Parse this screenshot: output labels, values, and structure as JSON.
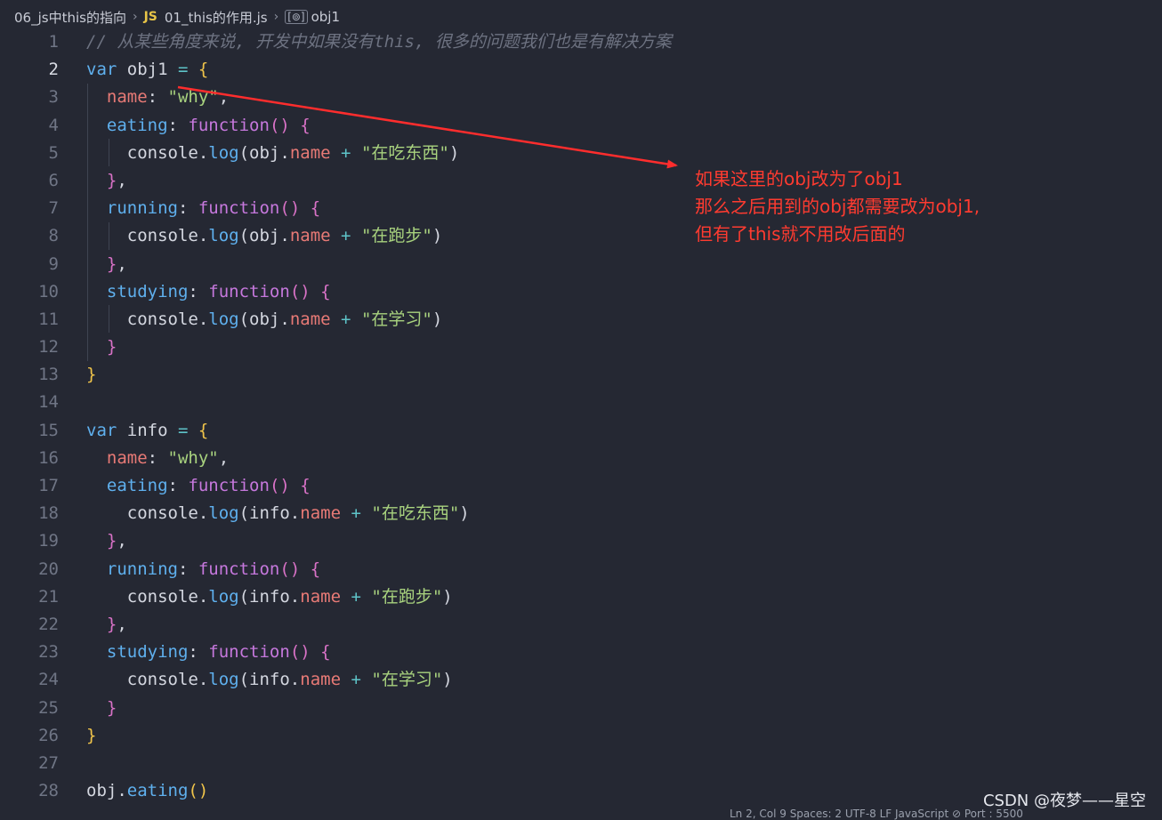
{
  "breadcrumb": {
    "folder": "06_js中this的指向",
    "file_type": "JS",
    "file": "01_this的作用.js",
    "symbol_icon": "symbol-variable-icon",
    "symbol": "obj1"
  },
  "editor": {
    "active_line": 2,
    "lines": [
      {
        "n": "1",
        "t": [
          {
            "c": "cmt",
            "v": "// 从某些角度来说, 开发中如果没有this, 很多的问题我们也是有解决方案"
          }
        ]
      },
      {
        "n": "2",
        "t": [
          {
            "c": "kwb",
            "v": "var"
          },
          {
            "c": "var",
            "v": " obj1 "
          },
          {
            "c": "op",
            "v": "="
          },
          {
            "c": "var",
            "v": " "
          },
          {
            "c": "br1",
            "v": "{"
          }
        ]
      },
      {
        "n": "3",
        "t": [
          {
            "c": "var",
            "v": "  "
          },
          {
            "c": "prop",
            "v": "name"
          },
          {
            "c": "var",
            "v": ": "
          },
          {
            "c": "str",
            "v": "\"why\""
          },
          {
            "c": "var",
            "v": ","
          }
        ]
      },
      {
        "n": "4",
        "t": [
          {
            "c": "var",
            "v": "  "
          },
          {
            "c": "fn",
            "v": "eating"
          },
          {
            "c": "var",
            "v": ": "
          },
          {
            "c": "kw",
            "v": "function"
          },
          {
            "c": "br2",
            "v": "()"
          },
          {
            "c": "var",
            "v": " "
          },
          {
            "c": "br2",
            "v": "{"
          }
        ]
      },
      {
        "n": "5",
        "t": [
          {
            "c": "var",
            "v": "    console."
          },
          {
            "c": "fn",
            "v": "log"
          },
          {
            "c": "var",
            "v": "(obj."
          },
          {
            "c": "prop",
            "v": "name"
          },
          {
            "c": "var",
            "v": " "
          },
          {
            "c": "op",
            "v": "+"
          },
          {
            "c": "var",
            "v": " "
          },
          {
            "c": "str",
            "v": "\"在吃东西\""
          },
          {
            "c": "var",
            "v": ")"
          }
        ]
      },
      {
        "n": "6",
        "t": [
          {
            "c": "var",
            "v": "  "
          },
          {
            "c": "br2",
            "v": "}"
          },
          {
            "c": "var",
            "v": ","
          }
        ]
      },
      {
        "n": "7",
        "t": [
          {
            "c": "var",
            "v": "  "
          },
          {
            "c": "fn",
            "v": "running"
          },
          {
            "c": "var",
            "v": ": "
          },
          {
            "c": "kw",
            "v": "function"
          },
          {
            "c": "br2",
            "v": "()"
          },
          {
            "c": "var",
            "v": " "
          },
          {
            "c": "br2",
            "v": "{"
          }
        ]
      },
      {
        "n": "8",
        "t": [
          {
            "c": "var",
            "v": "    console."
          },
          {
            "c": "fn",
            "v": "log"
          },
          {
            "c": "var",
            "v": "(obj."
          },
          {
            "c": "prop",
            "v": "name"
          },
          {
            "c": "var",
            "v": " "
          },
          {
            "c": "op",
            "v": "+"
          },
          {
            "c": "var",
            "v": " "
          },
          {
            "c": "str",
            "v": "\"在跑步\""
          },
          {
            "c": "var",
            "v": ")"
          }
        ]
      },
      {
        "n": "9",
        "t": [
          {
            "c": "var",
            "v": "  "
          },
          {
            "c": "br2",
            "v": "}"
          },
          {
            "c": "var",
            "v": ","
          }
        ]
      },
      {
        "n": "10",
        "t": [
          {
            "c": "var",
            "v": "  "
          },
          {
            "c": "fn",
            "v": "studying"
          },
          {
            "c": "var",
            "v": ": "
          },
          {
            "c": "kw",
            "v": "function"
          },
          {
            "c": "br2",
            "v": "()"
          },
          {
            "c": "var",
            "v": " "
          },
          {
            "c": "br2",
            "v": "{"
          }
        ]
      },
      {
        "n": "11",
        "t": [
          {
            "c": "var",
            "v": "    console."
          },
          {
            "c": "fn",
            "v": "log"
          },
          {
            "c": "var",
            "v": "(obj."
          },
          {
            "c": "prop",
            "v": "name"
          },
          {
            "c": "var",
            "v": " "
          },
          {
            "c": "op",
            "v": "+"
          },
          {
            "c": "var",
            "v": " "
          },
          {
            "c": "str",
            "v": "\"在学习\""
          },
          {
            "c": "var",
            "v": ")"
          }
        ]
      },
      {
        "n": "12",
        "t": [
          {
            "c": "var",
            "v": "  "
          },
          {
            "c": "br2",
            "v": "}"
          }
        ]
      },
      {
        "n": "13",
        "t": [
          {
            "c": "br1",
            "v": "}"
          }
        ]
      },
      {
        "n": "14",
        "t": []
      },
      {
        "n": "15",
        "t": [
          {
            "c": "kwb",
            "v": "var"
          },
          {
            "c": "var",
            "v": " info "
          },
          {
            "c": "op",
            "v": "="
          },
          {
            "c": "var",
            "v": " "
          },
          {
            "c": "br1",
            "v": "{"
          }
        ]
      },
      {
        "n": "16",
        "t": [
          {
            "c": "var",
            "v": "  "
          },
          {
            "c": "prop",
            "v": "name"
          },
          {
            "c": "var",
            "v": ": "
          },
          {
            "c": "str",
            "v": "\"why\""
          },
          {
            "c": "var",
            "v": ","
          }
        ]
      },
      {
        "n": "17",
        "t": [
          {
            "c": "var",
            "v": "  "
          },
          {
            "c": "fn",
            "v": "eating"
          },
          {
            "c": "var",
            "v": ": "
          },
          {
            "c": "kw",
            "v": "function"
          },
          {
            "c": "br2",
            "v": "()"
          },
          {
            "c": "var",
            "v": " "
          },
          {
            "c": "br2",
            "v": "{"
          }
        ]
      },
      {
        "n": "18",
        "t": [
          {
            "c": "var",
            "v": "    console."
          },
          {
            "c": "fn",
            "v": "log"
          },
          {
            "c": "var",
            "v": "(info."
          },
          {
            "c": "prop",
            "v": "name"
          },
          {
            "c": "var",
            "v": " "
          },
          {
            "c": "op",
            "v": "+"
          },
          {
            "c": "var",
            "v": " "
          },
          {
            "c": "str",
            "v": "\"在吃东西\""
          },
          {
            "c": "var",
            "v": ")"
          }
        ]
      },
      {
        "n": "19",
        "t": [
          {
            "c": "var",
            "v": "  "
          },
          {
            "c": "br2",
            "v": "}"
          },
          {
            "c": "var",
            "v": ","
          }
        ]
      },
      {
        "n": "20",
        "t": [
          {
            "c": "var",
            "v": "  "
          },
          {
            "c": "fn",
            "v": "running"
          },
          {
            "c": "var",
            "v": ": "
          },
          {
            "c": "kw",
            "v": "function"
          },
          {
            "c": "br2",
            "v": "()"
          },
          {
            "c": "var",
            "v": " "
          },
          {
            "c": "br2",
            "v": "{"
          }
        ]
      },
      {
        "n": "21",
        "t": [
          {
            "c": "var",
            "v": "    console."
          },
          {
            "c": "fn",
            "v": "log"
          },
          {
            "c": "var",
            "v": "(info."
          },
          {
            "c": "prop",
            "v": "name"
          },
          {
            "c": "var",
            "v": " "
          },
          {
            "c": "op",
            "v": "+"
          },
          {
            "c": "var",
            "v": " "
          },
          {
            "c": "str",
            "v": "\"在跑步\""
          },
          {
            "c": "var",
            "v": ")"
          }
        ]
      },
      {
        "n": "22",
        "t": [
          {
            "c": "var",
            "v": "  "
          },
          {
            "c": "br2",
            "v": "}"
          },
          {
            "c": "var",
            "v": ","
          }
        ]
      },
      {
        "n": "23",
        "t": [
          {
            "c": "var",
            "v": "  "
          },
          {
            "c": "fn",
            "v": "studying"
          },
          {
            "c": "var",
            "v": ": "
          },
          {
            "c": "kw",
            "v": "function"
          },
          {
            "c": "br2",
            "v": "()"
          },
          {
            "c": "var",
            "v": " "
          },
          {
            "c": "br2",
            "v": "{"
          }
        ]
      },
      {
        "n": "24",
        "t": [
          {
            "c": "var",
            "v": "    console."
          },
          {
            "c": "fn",
            "v": "log"
          },
          {
            "c": "var",
            "v": "(info."
          },
          {
            "c": "prop",
            "v": "name"
          },
          {
            "c": "var",
            "v": " "
          },
          {
            "c": "op",
            "v": "+"
          },
          {
            "c": "var",
            "v": " "
          },
          {
            "c": "str",
            "v": "\"在学习\""
          },
          {
            "c": "var",
            "v": ")"
          }
        ]
      },
      {
        "n": "25",
        "t": [
          {
            "c": "var",
            "v": "  "
          },
          {
            "c": "br2",
            "v": "}"
          }
        ]
      },
      {
        "n": "26",
        "t": [
          {
            "c": "br1",
            "v": "}"
          }
        ]
      },
      {
        "n": "27",
        "t": []
      },
      {
        "n": "28",
        "t": [
          {
            "c": "var",
            "v": "obj."
          },
          {
            "c": "fn",
            "v": "eating"
          },
          {
            "c": "br1",
            "v": "()"
          }
        ]
      }
    ]
  },
  "annotation": {
    "lines": [
      "如果这里的obj改为了obj1",
      "那么之后用到的obj都需要改为obj1,",
      "但有了this就不用改后面的"
    ],
    "color": "#ff3b30"
  },
  "watermark": "CSDN @夜梦——星空",
  "status_bar": "Ln 2, Col 9   Spaces: 2   UTF-8   LF   JavaScript   ⊘ Port : 5500"
}
